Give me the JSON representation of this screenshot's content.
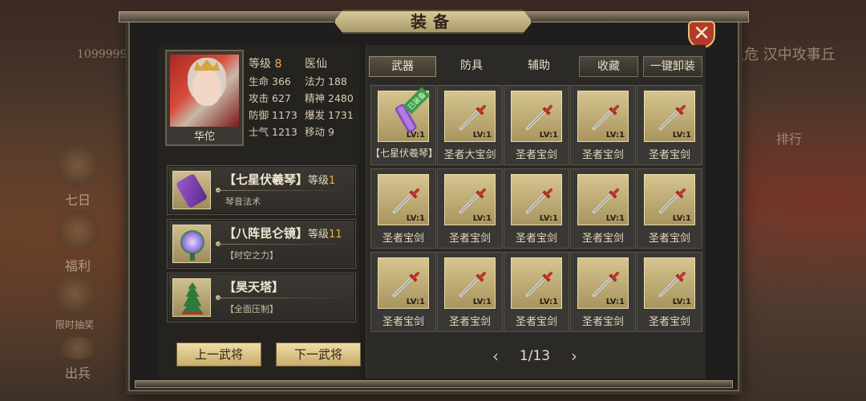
{
  "background": {
    "right_text": "川之危 汉中攻事丘",
    "left_text": "1099999",
    "side_buttons": [
      "七日",
      "福利",
      "限时抽奖",
      "出兵"
    ],
    "right_button": "排行"
  },
  "window": {
    "title": "装备",
    "close_label": "✕"
  },
  "hero": {
    "name": "华佗",
    "level_label": "等级",
    "level": "8",
    "class": "医仙",
    "stats": [
      {
        "label": "生命",
        "value": "366"
      },
      {
        "label": "法力",
        "value": "188"
      },
      {
        "label": "攻击",
        "value": "627"
      },
      {
        "label": "精神",
        "value": "2480"
      },
      {
        "label": "防御",
        "value": "1173"
      },
      {
        "label": "爆发",
        "value": "1731"
      },
      {
        "label": "士气",
        "value": "1213"
      },
      {
        "label": "移动",
        "value": "9"
      }
    ]
  },
  "treasures": [
    {
      "name": "【七星伏羲琴】",
      "level_label": "等级",
      "level": "1",
      "desc": "琴音法术",
      "icon": "qin-icon"
    },
    {
      "name": "【八阵昆仑镜】",
      "level_label": "等级",
      "level": "11",
      "desc": "【时空之力】",
      "icon": "mirror-icon"
    },
    {
      "name": "【昊天塔】",
      "level_label": "",
      "level": "",
      "desc": "【全面压制】",
      "icon": "pagoda-icon"
    }
  ],
  "buttons": {
    "prev": "上一武将",
    "next": "下一武将"
  },
  "tabs": {
    "weapon": "武器",
    "armor": "防具",
    "accessory": "辅助",
    "favorite": "收藏",
    "unequip_all": "一键卸装"
  },
  "items": [
    {
      "name": "【七星伏羲琴】",
      "lv": "LV:1",
      "icon": "qin-icon",
      "badge": "已装备"
    },
    {
      "name": "圣者大宝剑",
      "lv": "LV:1",
      "icon": "sword-icon"
    },
    {
      "name": "圣者宝剑",
      "lv": "LV:1",
      "icon": "sword-icon"
    },
    {
      "name": "圣者宝剑",
      "lv": "LV:1",
      "icon": "sword-icon"
    },
    {
      "name": "圣者宝剑",
      "lv": "LV:1",
      "icon": "sword-icon"
    },
    {
      "name": "圣者宝剑",
      "lv": "LV:1",
      "icon": "sword-icon"
    },
    {
      "name": "圣者宝剑",
      "lv": "LV:1",
      "icon": "sword-icon"
    },
    {
      "name": "圣者宝剑",
      "lv": "LV:1",
      "icon": "sword-icon"
    },
    {
      "name": "圣者宝剑",
      "lv": "LV:1",
      "icon": "sword-icon"
    },
    {
      "name": "圣者宝剑",
      "lv": "LV:1",
      "icon": "sword-icon"
    },
    {
      "name": "圣者宝剑",
      "lv": "LV:1",
      "icon": "sword-icon"
    },
    {
      "name": "圣者宝剑",
      "lv": "LV:1",
      "icon": "sword-icon"
    },
    {
      "name": "圣者宝剑",
      "lv": "LV:1",
      "icon": "sword-icon"
    },
    {
      "name": "圣者宝剑",
      "lv": "LV:1",
      "icon": "sword-icon"
    },
    {
      "name": "圣者宝剑",
      "lv": "LV:1",
      "icon": "sword-icon"
    }
  ],
  "pager": {
    "text": "1/13",
    "prev": "‹",
    "next": "›"
  }
}
